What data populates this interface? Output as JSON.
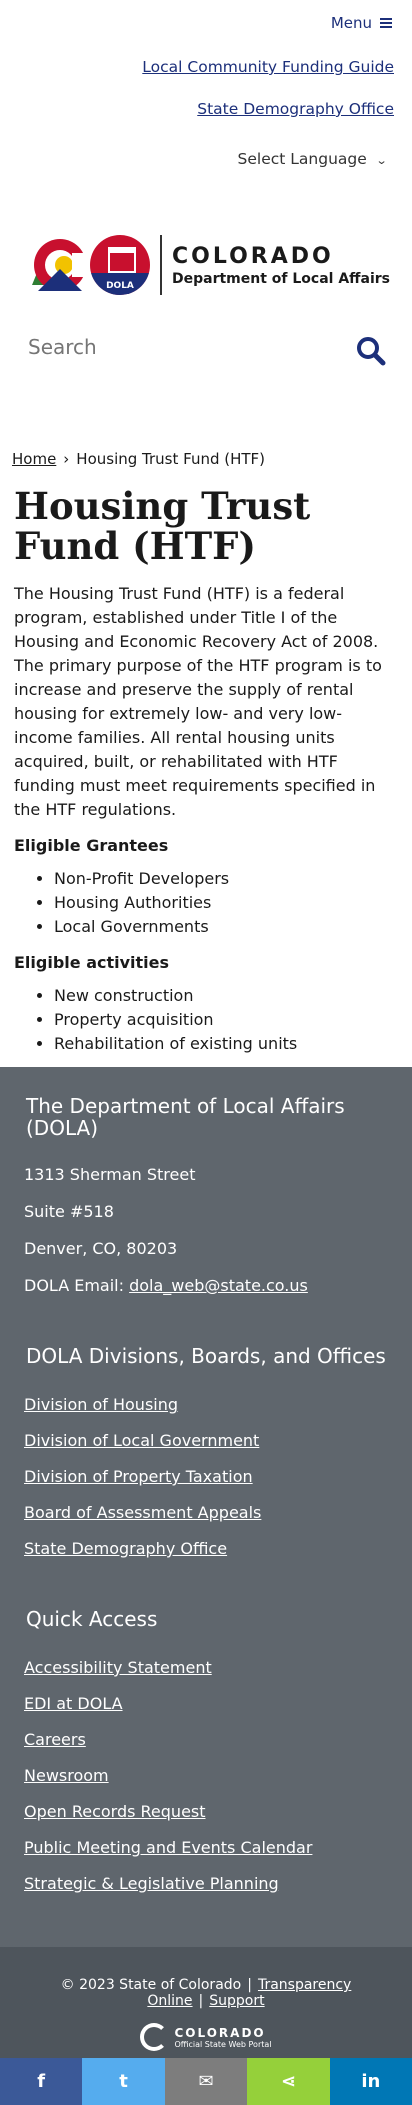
{
  "header": {
    "menu_label": "Menu",
    "utility_links": [
      "Local Community Funding Guide",
      "State Demography Office"
    ],
    "language_label": "Select Language",
    "logo": {
      "state": "COLORADO",
      "dept": "Department of Local Affairs",
      "badge": "DOLA"
    },
    "search_placeholder": "Search"
  },
  "breadcrumb": {
    "home": "Home",
    "current": "Housing Trust Fund (HTF)"
  },
  "main": {
    "title": "Housing Trust Fund (HTF)",
    "intro": "The Housing Trust Fund (HTF) is a federal program, established under Title I of the Housing and Economic Recovery Act of 2008. The primary purpose of the HTF program is to increase and preserve the supply of rental housing for extremely low- and very low-income families. All rental housing units acquired, built, or rehabilitated with HTF funding must meet requirements specified in the HTF regulations.",
    "grantees_heading": "Eligible Grantees",
    "grantees": [
      "Non-Profit Developers",
      "Housing Authorities",
      "Local Governments"
    ],
    "activities_heading": "Eligible activities",
    "activities": [
      "New construction",
      "Property acquisition",
      "Rehabilitation of existing units"
    ]
  },
  "footer": {
    "dept_heading": "The Department of Local Affairs (DOLA)",
    "address_1": "1313 Sherman Street",
    "address_2": "Suite  #518",
    "address_3": "Denver, CO, 80203",
    "email_label": "DOLA Email: ",
    "email": "dola_web@state.co.us",
    "divisions_heading": "DOLA Divisions, Boards, and Offices",
    "divisions": [
      "Division of Housing",
      "Division of Local Government",
      "Division of Property Taxation",
      "Board of Assessment Appeals",
      "State Demography Office"
    ],
    "quick_heading": "Quick Access",
    "quick": [
      "Accessibility Statement",
      "EDI at DOLA",
      "Careers",
      "Newsroom",
      "Open Records Request",
      "Public Meeting and Events Calendar",
      "Strategic & Legislative Planning"
    ]
  },
  "bottom": {
    "copyright": "© 2023 State of Colorado",
    "transparency": "Transparency Online",
    "support": "Support",
    "state_logo_1": "COLORADO",
    "state_logo_2": "Official State Web Portal"
  },
  "share": [
    {
      "icon": "facebook-icon",
      "glyph": "f",
      "color": "#3b5998"
    },
    {
      "icon": "twitter-icon",
      "glyph": "t",
      "color": "#55acee"
    },
    {
      "icon": "email-icon",
      "glyph": "✉",
      "color": "#7d7d7d"
    },
    {
      "icon": "share-icon",
      "glyph": "⋖",
      "color": "#95d03a"
    },
    {
      "icon": "linkedin-icon",
      "glyph": "in",
      "color": "#0077b5"
    }
  ]
}
